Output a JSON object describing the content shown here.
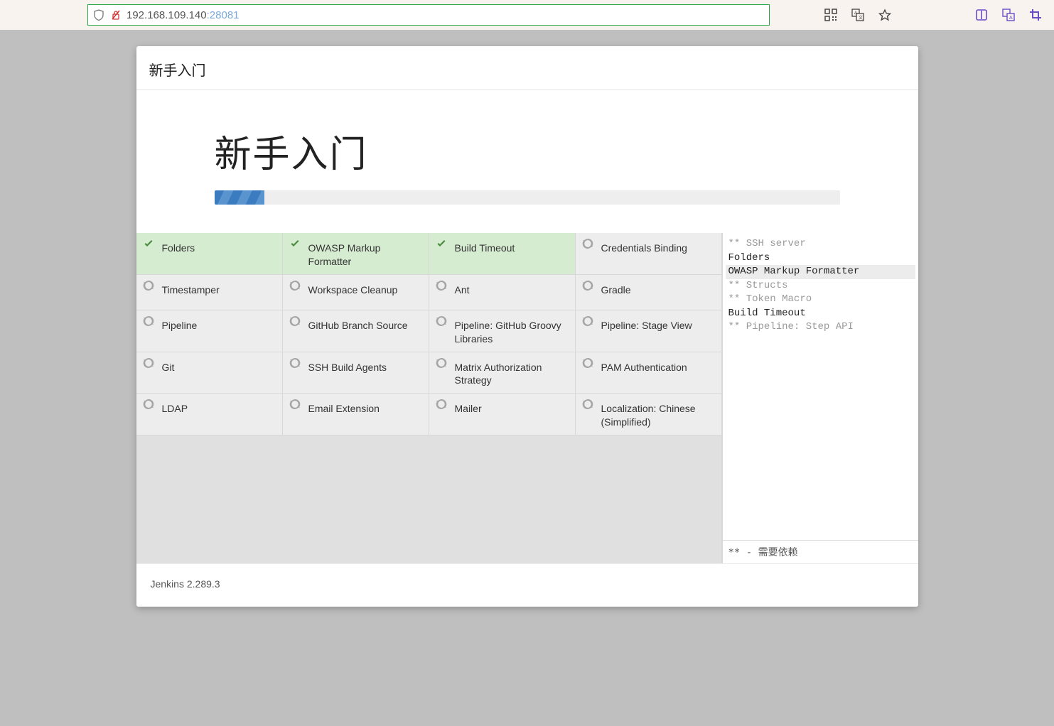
{
  "browser": {
    "url_host": "192.168.109.140",
    "url_port": ":28081"
  },
  "header": {
    "title": "新手入门"
  },
  "hero": {
    "title": "新手入门"
  },
  "progress": {
    "percent": 8
  },
  "plugins": [
    {
      "label": "Folders",
      "status": "done"
    },
    {
      "label": "OWASP Markup Formatter",
      "status": "done"
    },
    {
      "label": "Build Timeout",
      "status": "done"
    },
    {
      "label": "Credentials Binding",
      "status": "pending"
    },
    {
      "label": "Timestamper",
      "status": "pending"
    },
    {
      "label": "Workspace Cleanup",
      "status": "pending"
    },
    {
      "label": "Ant",
      "status": "pending"
    },
    {
      "label": "Gradle",
      "status": "pending"
    },
    {
      "label": "Pipeline",
      "status": "pending"
    },
    {
      "label": "GitHub Branch Source",
      "status": "pending"
    },
    {
      "label": "Pipeline: GitHub Groovy Libraries",
      "status": "pending"
    },
    {
      "label": "Pipeline: Stage View",
      "status": "pending"
    },
    {
      "label": "Git",
      "status": "pending"
    },
    {
      "label": "SSH Build Agents",
      "status": "pending"
    },
    {
      "label": "Matrix Authorization Strategy",
      "status": "pending"
    },
    {
      "label": "PAM Authentication",
      "status": "pending"
    },
    {
      "label": "LDAP",
      "status": "pending"
    },
    {
      "label": "Email Extension",
      "status": "pending"
    },
    {
      "label": "Mailer",
      "status": "pending"
    },
    {
      "label": "Localization: Chinese (Simplified)",
      "status": "pending"
    }
  ],
  "log": [
    {
      "text": "** SSH server",
      "type": "dep"
    },
    {
      "text": "Folders",
      "type": "installed"
    },
    {
      "text": "OWASP Markup Formatter",
      "type": "current"
    },
    {
      "text": "** Structs",
      "type": "dep"
    },
    {
      "text": "** Token Macro",
      "type": "dep"
    },
    {
      "text": "Build Timeout",
      "type": "installed"
    },
    {
      "text": "** Pipeline: Step API",
      "type": "dep"
    }
  ],
  "sidepane_footer": "**  -  需要依赖",
  "footer": {
    "version": "Jenkins 2.289.3"
  }
}
